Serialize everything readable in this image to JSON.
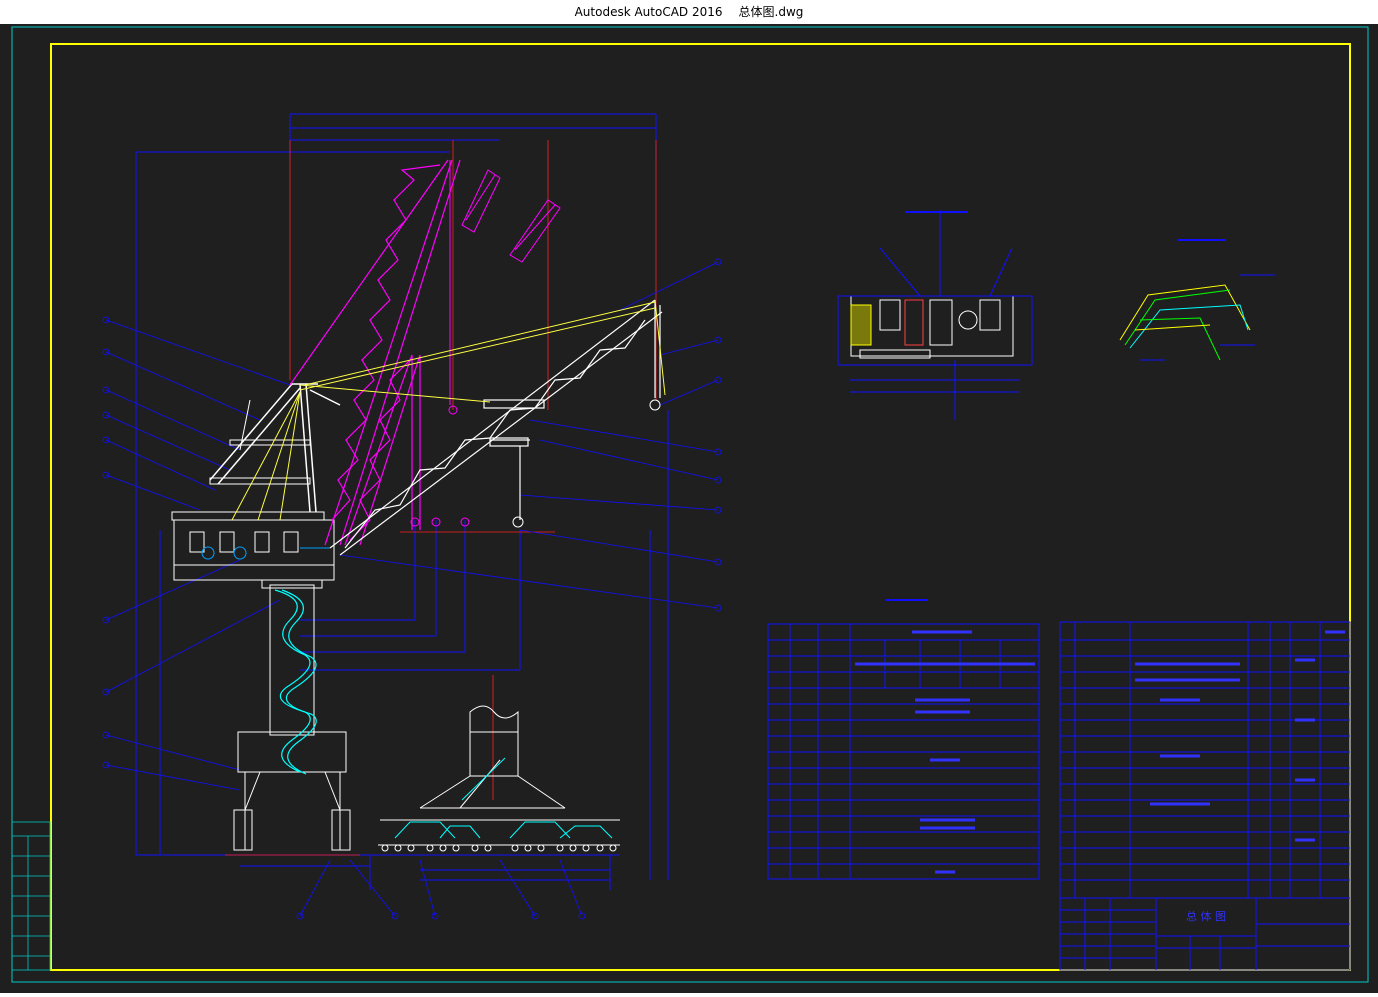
{
  "window": {
    "app_title": "Autodesk AutoCAD 2016",
    "file_name": "总体图.dwg",
    "sysmenu_icon": "grip-icon"
  },
  "drawing": {
    "colors": {
      "background": "#1f1f1f",
      "border_yellow": "#ffff00",
      "outer_frame_cyan": "#00c8c8",
      "dimension_blue": "#1010ff",
      "crane_white": "#ffffff",
      "boom_magenta": "#ff00ff",
      "rope_yellow": "#ffff44",
      "stair_cyan": "#00ffff",
      "centerline_red": "#ff2020"
    },
    "title_block_name": "总 体 图"
  }
}
